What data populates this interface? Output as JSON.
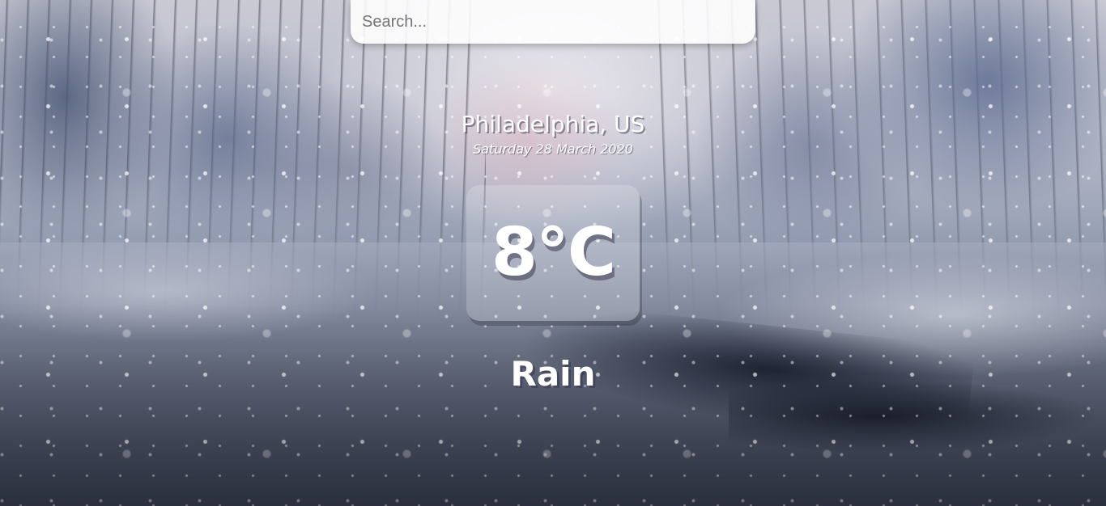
{
  "search": {
    "placeholder": "Search...",
    "value": ""
  },
  "location": {
    "name": "Philadelphia, US",
    "date": "Saturday 28 March 2020"
  },
  "weather": {
    "temperature": "8°C",
    "condition": "Rain"
  },
  "background": {
    "scene": "snowy-forest-river",
    "text_color": "#ffffff"
  }
}
